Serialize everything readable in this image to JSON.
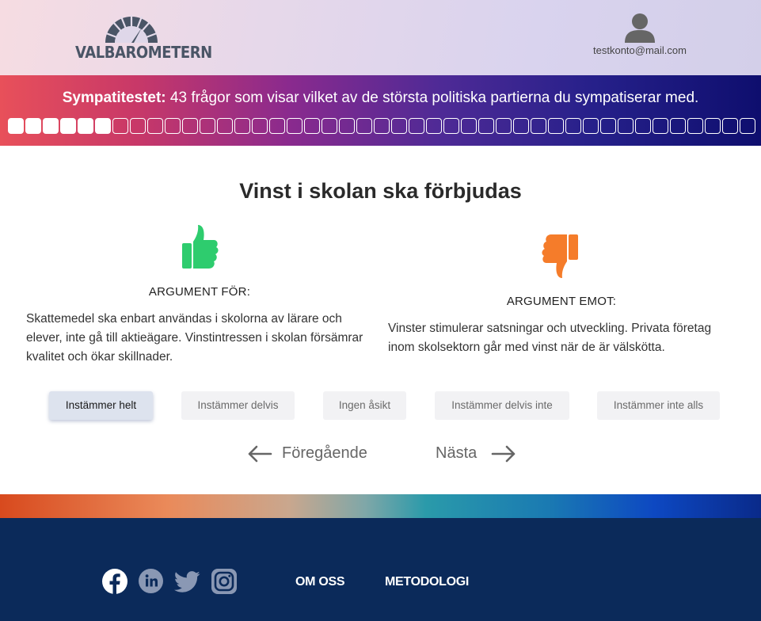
{
  "header": {
    "logo_text": "VALBAROMETERN",
    "user_email": "testkonto@mail.com"
  },
  "banner": {
    "title_bold": "Sympatitestet:",
    "title_rest": " 43 frågor som visar vilket av de största politiska partierna du sympatiserar med.",
    "total_questions": 43,
    "answered": 6
  },
  "question": {
    "title": "Vinst i skolan ska förbjudas",
    "for_heading": "ARGUMENT FÖR:",
    "for_text": "Skattemedel ska enbart användas i skolorna av lärare och elever, inte gå till aktieägare. Vinstintressen i skolan försämrar kvalitet och ökar skillnader.",
    "against_heading": "ARGUMENT EMOT:",
    "against_text": "Vinster stimulerar satsningar och utveckling. Privata företag inom skolsektorn går med vinst när de är välskötta."
  },
  "options": {
    "agree_fully": "Instämmer helt",
    "agree_partly": "Instämmer delvis",
    "no_opinion": "Ingen åsikt",
    "disagree_partly": "Instämmer delvis inte",
    "disagree_fully": "Instämmer inte alls",
    "selected": "Instämmer helt"
  },
  "navigation": {
    "previous": "Föregående",
    "next": "Nästa"
  },
  "footer": {
    "about": "OM OSS",
    "methodology": "METODOLOGI"
  },
  "colors": {
    "thumb_up": "#2ecc6e",
    "thumb_down": "#f57c2a",
    "footer_bg": "#0b2a5a"
  }
}
